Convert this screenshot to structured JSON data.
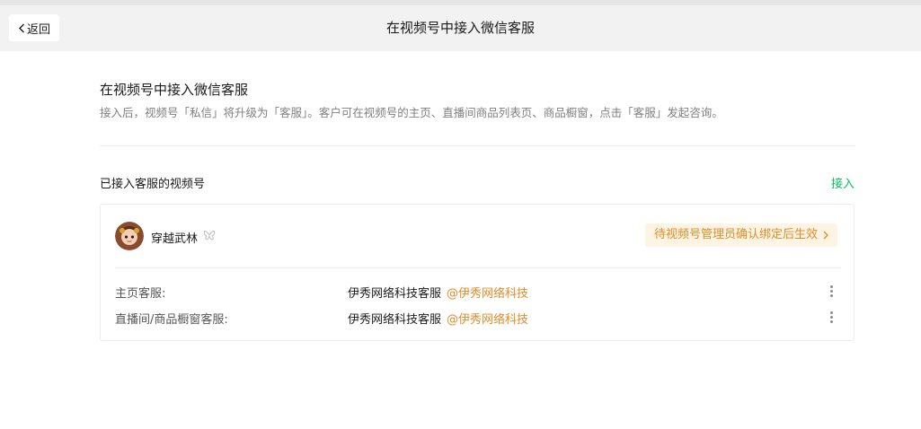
{
  "header": {
    "back_label": "返回",
    "title": "在视频号中接入微信客服"
  },
  "intro": {
    "title": "在视频号中接入微信客服",
    "description": "接入后，视频号「私信」将升级为「客服」。客户可在视频号的主页、直播间商品列表页、商品橱窗，点击「客服」发起咨询。"
  },
  "accounts_section": {
    "title": "已接入客服的视频号",
    "connect_label": "接入"
  },
  "account_card": {
    "name": "穿越武林",
    "badge_icon": "butterfly-icon",
    "status_text": "待视频号管理员确认绑定后生效",
    "rows": [
      {
        "label": "主页客服:",
        "service_name": "伊秀网络科技客服",
        "handle": "@伊秀网络科技"
      },
      {
        "label": "直播间/商品橱窗客服:",
        "service_name": "伊秀网络科技客服",
        "handle": "@伊秀网络科技"
      }
    ]
  },
  "colors": {
    "accent_green": "#07c160",
    "status_orange": "#e28b2a",
    "status_bg": "#fdf4e3"
  }
}
